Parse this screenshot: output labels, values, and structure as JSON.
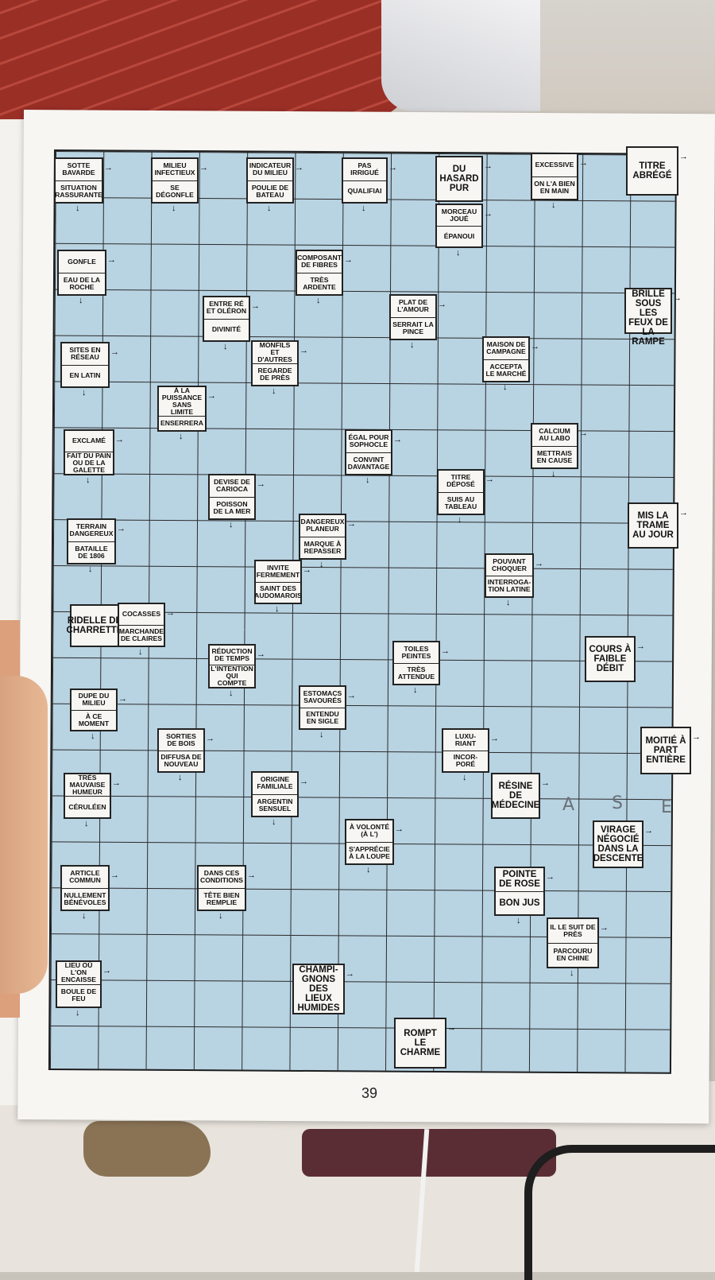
{
  "page_number": "39",
  "clues": [
    {
      "id": "sotte",
      "a": "SOTTE BAVARDE",
      "b": "SITUATION RASSURANTE"
    },
    {
      "id": "milieu",
      "a": "MILIEU INFECTIEUX",
      "b": "SE DÉGONFLE"
    },
    {
      "id": "indicateur",
      "a": "INDICATEUR DU MILIEU",
      "b": "POULIE DE BATEAU"
    },
    {
      "id": "pasirrigue",
      "a": "PAS IRRIGUÉ",
      "b": "QUALIFIAI"
    },
    {
      "id": "duhasard",
      "a": "DU HASARD PUR",
      "b": ""
    },
    {
      "id": "morceau",
      "a": "MORCEAU JOUÉ",
      "b": "ÉPANOUI"
    },
    {
      "id": "excessive",
      "a": "EXCESSIVE",
      "b": "ON L'A BIEN EN MAIN"
    },
    {
      "id": "titre",
      "a": "TITRE ABRÉGÉ",
      "b": ""
    },
    {
      "id": "gonfle",
      "a": "GONFLE",
      "b": "EAU DE LA ROCHE"
    },
    {
      "id": "composant",
      "a": "COMPOSANT DE FIBRES",
      "b": "TRÈS ARDENTE"
    },
    {
      "id": "entre",
      "a": "ENTRE RÉ ET OLÉRON",
      "b": "DIVINITÉ"
    },
    {
      "id": "plat",
      "a": "PLAT DE L'AMOUR",
      "b": "SERRAIT LA PINCE"
    },
    {
      "id": "brille",
      "a": "BRILLE SOUS LES FEUX DE LA RAMPE",
      "b": ""
    },
    {
      "id": "sites",
      "a": "SITES EN RÉSEAU",
      "b": "EN LATIN"
    },
    {
      "id": "monfils",
      "a": "MONFILS ET D'AUTRES",
      "b": "REGARDE DE PRÈS"
    },
    {
      "id": "maison",
      "a": "MAISON DE CAMPAGNE",
      "b": "ACCEPTA LE MARCHÉ"
    },
    {
      "id": "puissance",
      "a": "À LA PUISSANCE SANS LIMITE",
      "b": "ENSERRERA"
    },
    {
      "id": "exclame",
      "a": "EXCLAMÉ",
      "b": "FAIT DU PAIN OU DE LA GALETTE"
    },
    {
      "id": "egal",
      "a": "ÉGAL POUR SOPHOCLE",
      "b": "CONVINT DAVANTAGE"
    },
    {
      "id": "calcium",
      "a": "CALCIUM AU LABO",
      "b": "METTRAIS EN CAUSE"
    },
    {
      "id": "devise",
      "a": "DEVISE DE CARIOCA",
      "b": "POISSON DE LA MER"
    },
    {
      "id": "titredepose",
      "a": "TITRE DÉPOSÉ",
      "b": "SUIS AU TABLEAU"
    },
    {
      "id": "terrain",
      "a": "TERRAIN DANGEREUX",
      "b": "BATAILLE DE 1806"
    },
    {
      "id": "dangereux",
      "a": "DANGEREUX PLANEUR",
      "b": "MARQUE À REPASSER"
    },
    {
      "id": "trame",
      "a": "MIS LA TRAME AU JOUR",
      "b": ""
    },
    {
      "id": "invite",
      "a": "INVITE FERMEMENT",
      "b": "SAINT DES AUDOMAROIS"
    },
    {
      "id": "pouvant",
      "a": "POUVANT CHOQUER",
      "b": "INTERROGA- TION LATINE"
    },
    {
      "id": "ridelle",
      "a": "RIDELLE DE CHARRETTE",
      "b": ""
    },
    {
      "id": "cocasses",
      "a": "COCASSES",
      "b": "MARCHANDE DE CLAIRES"
    },
    {
      "id": "reduction",
      "a": "RÉDUCTION DE TEMPS",
      "b": "L'INTENTION QUI COMPTE"
    },
    {
      "id": "toiles",
      "a": "TOILES PEINTES",
      "b": "TRÈS ATTENDUE"
    },
    {
      "id": "cours",
      "a": "COURS À FAIBLE DÉBIT",
      "b": ""
    },
    {
      "id": "dupe",
      "a": "DUPE DU MILIEU",
      "b": "À CE MOMENT"
    },
    {
      "id": "estomacs",
      "a": "ESTOMACS SAVOURÉS",
      "b": "ENTENDU EN SIGLE"
    },
    {
      "id": "sorties",
      "a": "SORTIES DE BOIS",
      "b": "DIFFUSA DE NOUVEAU"
    },
    {
      "id": "luxuriant",
      "a": "LUXU- RIANT",
      "b": "INCOR- PORÉ"
    },
    {
      "id": "moitie",
      "a": "MOITIÉ À PART ENTIÈRE",
      "b": ""
    },
    {
      "id": "tres",
      "a": "TRÈS MAUVAISE HUMEUR",
      "b": "CÉRULÉEN"
    },
    {
      "id": "origine",
      "a": "ORIGINE FAMILIALE",
      "b": "ARGENTIN SENSUEL"
    },
    {
      "id": "resine",
      "a": "RÉSINE DE MÉDECINE",
      "b": ""
    },
    {
      "id": "volonte",
      "a": "À VOLONTÉ (À L')",
      "b": "S'APPRÉCIE À LA LOUPE"
    },
    {
      "id": "virage",
      "a": "VIRAGE NÉGOCIÉ DANS LA DESCENTE",
      "b": ""
    },
    {
      "id": "article",
      "a": "ARTICLE COMMUN",
      "b": "NULLEMENT BÉNÉVOLES"
    },
    {
      "id": "dansces",
      "a": "DANS CES CONDITIONS",
      "b": "TÊTE BIEN REMPLIE"
    },
    {
      "id": "pointe",
      "a": "POINTE DE ROSE",
      "b": "BON JUS"
    },
    {
      "id": "ilesuit",
      "a": "IL LE SUIT DE PRÈS",
      "b": "PARCOURU EN CHINE"
    },
    {
      "id": "lieu",
      "a": "LIEU OÙ L'ON ENCAISSE",
      "b": "BOULE DE FEU"
    },
    {
      "id": "champignons",
      "a": "CHAMPI- GNONS DES LIEUX HUMIDES",
      "b": ""
    },
    {
      "id": "rompt",
      "a": "ROMPT LE CHARME",
      "b": ""
    }
  ],
  "handwritten": [
    "A",
    "S",
    "E"
  ]
}
